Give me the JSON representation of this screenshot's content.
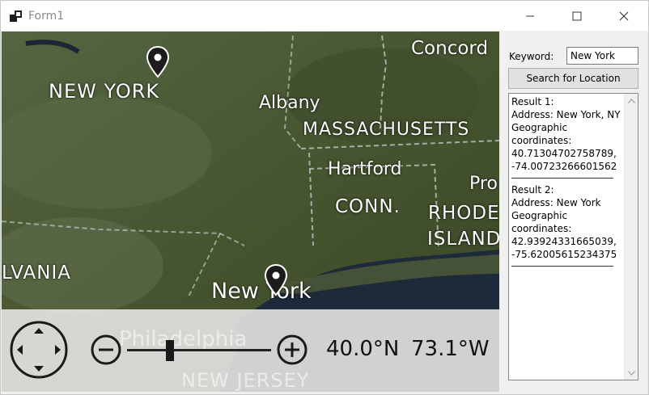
{
  "window": {
    "title": "Form1"
  },
  "map": {
    "labels": {
      "concord": "Concord",
      "new_york_state": "NEW YORK",
      "albany": "Albany",
      "massachusetts": "MASSACHUSETTS",
      "hartford": "Hartford",
      "providence": "Pro",
      "conn": "CONN.",
      "rhode": "RHODE",
      "island": "ISLAND",
      "pennsylvania": "LVANIA",
      "new_york_city": "New York",
      "philadelphia": "Philadelphia",
      "new_jersey": "NEW JERSEY"
    },
    "pins": [
      {
        "name": "result-2-location"
      },
      {
        "name": "result-1-location"
      }
    ],
    "controls": {
      "latitude": "40.0°N",
      "longitude": "73.1°W",
      "zoom_level_fraction": 0.3
    }
  },
  "side": {
    "keyword_label": "Keyword:",
    "keyword_value": "New York",
    "search_button": "Search for Location",
    "results": [
      {
        "title": "Result 1:",
        "address": "Address: New York, NY",
        "geo_label_1": "Geographic",
        "geo_label_2": "coordinates:",
        "lat": "40.71304702758789,",
        "lon": "-74.00723266601562"
      },
      {
        "title": "Result 2:",
        "address": "Address: New York",
        "geo_label_1": "Geographic",
        "geo_label_2": "coordinates:",
        "lat": "42.93924331665039,",
        "lon": "-75.62005615234375"
      }
    ]
  },
  "colors": {
    "land": "#4a5a36",
    "water": "#1d2a3a",
    "accent_text": "#ffffff",
    "pin": "#1c1c1c"
  }
}
